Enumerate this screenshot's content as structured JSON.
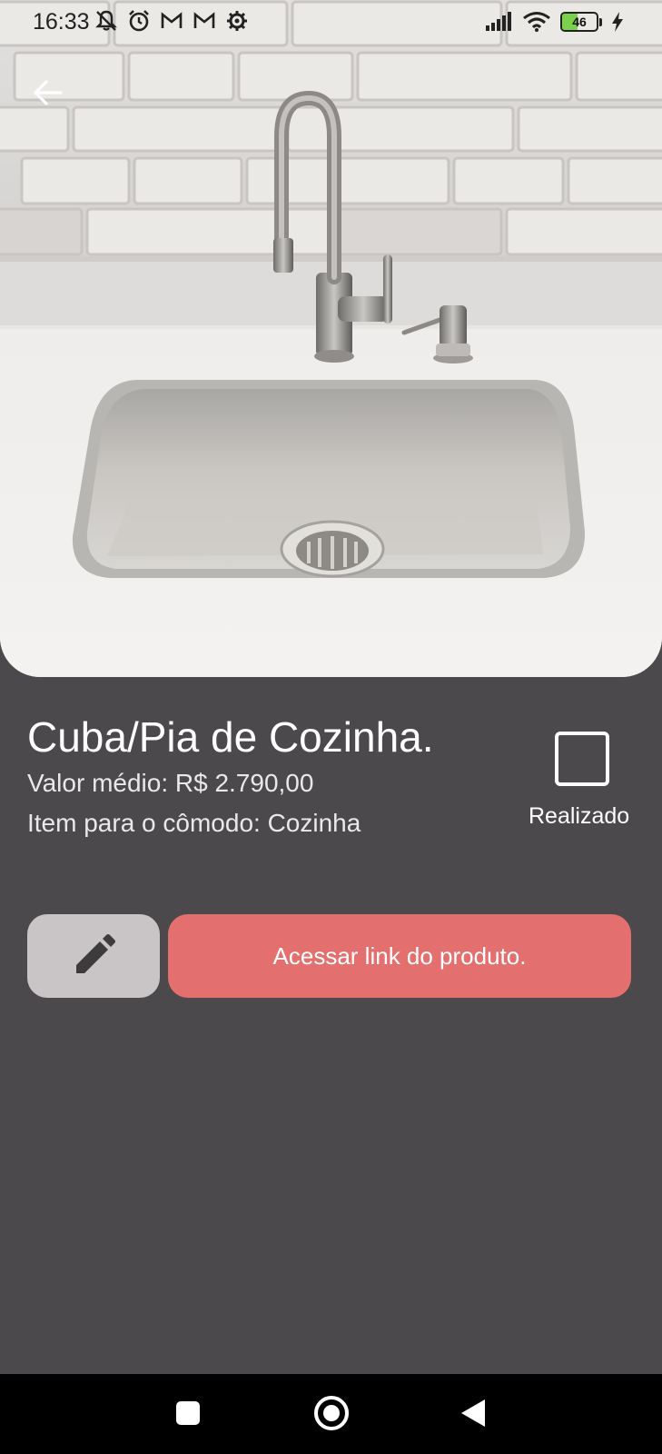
{
  "status_bar": {
    "time": "16:33",
    "battery": "46",
    "battery_level": 0.46,
    "left_icons": [
      "mute-notifications-icon",
      "alarm-icon",
      "gmail-icon",
      "gmail-icon",
      "settings-icon"
    ],
    "right_icons": [
      "signal-icon",
      "wifi-icon",
      "battery-icon",
      "charging-icon"
    ]
  },
  "header": {
    "back_icon": "arrow-left-icon",
    "image_subject": "kitchen sink"
  },
  "item": {
    "title": "Cuba/Pia de Cozinha.",
    "price": "Valor médio: R$ 2.790,00",
    "room": "Item para o cômodo: Cozinha",
    "done_label": "Realizado",
    "done_checked": false
  },
  "actions": {
    "edit_icon": "pencil-icon",
    "link_label": "Acessar link do produto."
  },
  "nav_bar": {
    "buttons": [
      "recent-apps",
      "home",
      "back"
    ]
  },
  "colors": {
    "background": "#4b494b",
    "link_button": "#e36f6f",
    "edit_button": "#c9c5c6",
    "battery_fill": "#7bd14b"
  }
}
